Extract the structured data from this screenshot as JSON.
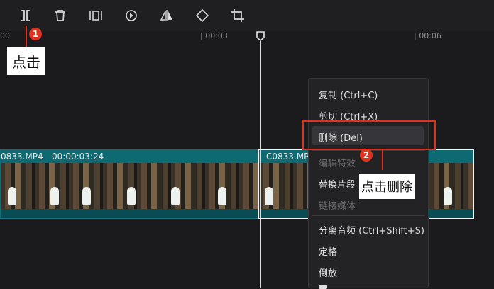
{
  "toolbar": {
    "tools": [
      "split-icon",
      "delete-icon",
      "freeze-frame-icon",
      "reverse-icon",
      "mirror-icon",
      "rotate-icon",
      "crop-icon"
    ]
  },
  "ruler": {
    "labels": [
      "00",
      "| 00:03",
      "| 00:06"
    ]
  },
  "clips": [
    {
      "name": "0833.MP4",
      "duration": "00:00:03:24"
    },
    {
      "name": "C0833.MP4",
      "duration": ""
    }
  ],
  "context_menu": {
    "items": [
      {
        "label": "复制 (Ctrl+C)",
        "enabled": true
      },
      {
        "label": "剪切 (Ctrl+X)",
        "enabled": true
      },
      {
        "label": "删除 (Del)",
        "enabled": true
      },
      {
        "label": "编辑特效",
        "enabled": false
      },
      {
        "label": "替换片段",
        "enabled": true
      },
      {
        "label": "链接媒体",
        "enabled": false
      },
      {
        "label": "分离音频 (Ctrl+Shift+S)",
        "enabled": true
      },
      {
        "label": "定格",
        "enabled": true
      },
      {
        "label": "倒放",
        "enabled": true
      }
    ]
  },
  "annotations": {
    "step1_number": "1",
    "step1_text": "点击",
    "step2_number": "2",
    "step2_text": "点击删除"
  },
  "colors": {
    "annotation_red": "#e0301e",
    "clip_teal": "#0c5c63",
    "background": "#1b1b1d"
  }
}
